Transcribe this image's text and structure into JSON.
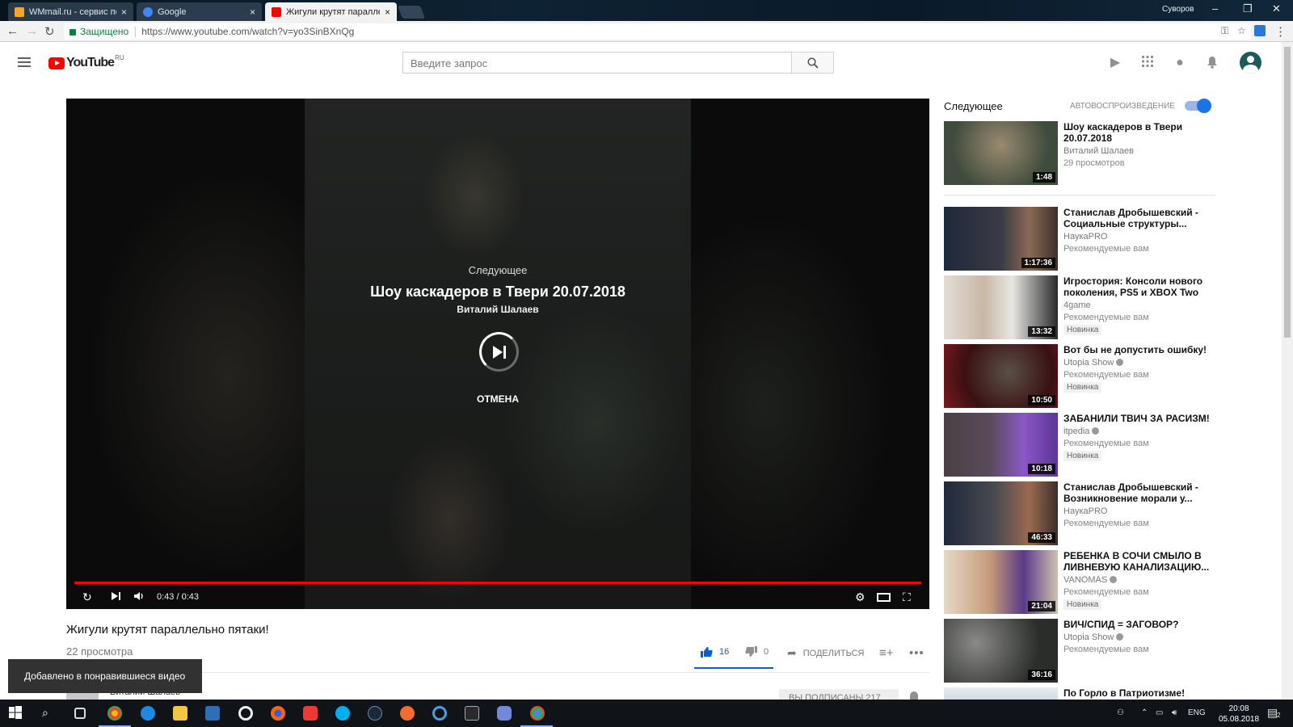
{
  "browser": {
    "tabs": [
      {
        "title": "WMmail.ru - сервис почт",
        "favicon_color": "#f4a522"
      },
      {
        "title": "Google",
        "favicon_color": "#4285f4"
      },
      {
        "title": "Жигули крутят паралле",
        "favicon_color": "#ff0000"
      }
    ],
    "window_user": "Суворов",
    "security_label": "Защищено",
    "url": "https://www.youtube.com/watch?v=yo3SinBXnQg"
  },
  "youtube": {
    "logo_text": "YouTube",
    "region": "RU",
    "search_placeholder": "Введите запрос"
  },
  "player": {
    "up_next_label": "Следующее",
    "up_next_title": "Шоу каскадеров в Твери 20.07.2018",
    "up_next_channel": "Виталий Шалаев",
    "cancel_label": "ОТМЕНА",
    "time": "0:43 / 0:43",
    "progress": 1.0
  },
  "video": {
    "title": "Жигули крутят параллельно пятаки!",
    "views": "22 просмотра",
    "likes": "16",
    "dislikes": "0",
    "share_label": "ПОДЕЛИТЬСЯ",
    "channel": "Виталий Шалаев",
    "subscribed_label": "ВЫ ПОДПИСАНЫ 217"
  },
  "toast": "Добавлено в понравившиеся видео",
  "sidebar": {
    "header": "Следующее",
    "autoplay_label": "АВТОВОСПРОИЗВЕДЕНИЕ",
    "autoplay_on": true,
    "items": [
      {
        "title": "Шоу каскадеров в Твери 20.07.2018",
        "channel": "Виталий Шалаев",
        "meta": "29 просмотров",
        "badge": "",
        "duration": "1:48",
        "thumb_color": "#4a5a48"
      },
      {
        "title": "Станислав Дробышевский - Социальные структуры...",
        "channel": "НаукаPRO",
        "meta": "Рекомендуемые вам",
        "badge": "",
        "duration": "1:17:36",
        "thumb_color": "#5d4a40"
      },
      {
        "title": "Игростория: Консоли нового поколения, PS5 и XBOX Two",
        "channel": "4game",
        "meta": "Рекомендуемые вам",
        "badge": "Новинка",
        "duration": "13:32",
        "thumb_color": "#c9c4be"
      },
      {
        "title": "Вот бы не допустить ошибку!",
        "channel": "Utopia Show",
        "meta": "Рекомендуемые вам",
        "badge": "Новинка",
        "duration": "10:50",
        "thumb_color": "#6a1a1c"
      },
      {
        "title": "ЗАБАНИЛИ ТВИЧ ЗА РАСИЗМ!",
        "channel": "itpedia",
        "meta": "Рекомендуемые вам",
        "badge": "Новинка",
        "duration": "10:18",
        "thumb_color": "#6b3a9a"
      },
      {
        "title": "Станислав Дробышевский - Возникновение морали у...",
        "channel": "НаукаPRO",
        "meta": "Рекомендуемые вам",
        "badge": "",
        "duration": "46:33",
        "thumb_color": "#5a4a42"
      },
      {
        "title": "РЕБЕНКА В СОЧИ СМЫЛО В ЛИВНЕВУЮ КАНАЛИЗАЦИЮ...",
        "channel": "VANOMAS",
        "meta": "Рекомендуемые вам",
        "badge": "Новинка",
        "duration": "21:04",
        "thumb_color": "#c7a07a"
      },
      {
        "title": "ВИЧ/СПИД = ЗАГОВОР?",
        "channel": "Utopia Show",
        "meta": "Рекомендуемые вам",
        "badge": "",
        "duration": "36:16",
        "thumb_color": "#3a3d3a"
      },
      {
        "title": "По Горло в Патриотизме!",
        "channel": "",
        "meta": "",
        "badge": "",
        "duration": "",
        "thumb_color": "#6f8fa0"
      }
    ]
  },
  "taskbar": {
    "lang": "ENG",
    "time": "20:08",
    "date": "05.08.2018",
    "notifications": "2"
  }
}
